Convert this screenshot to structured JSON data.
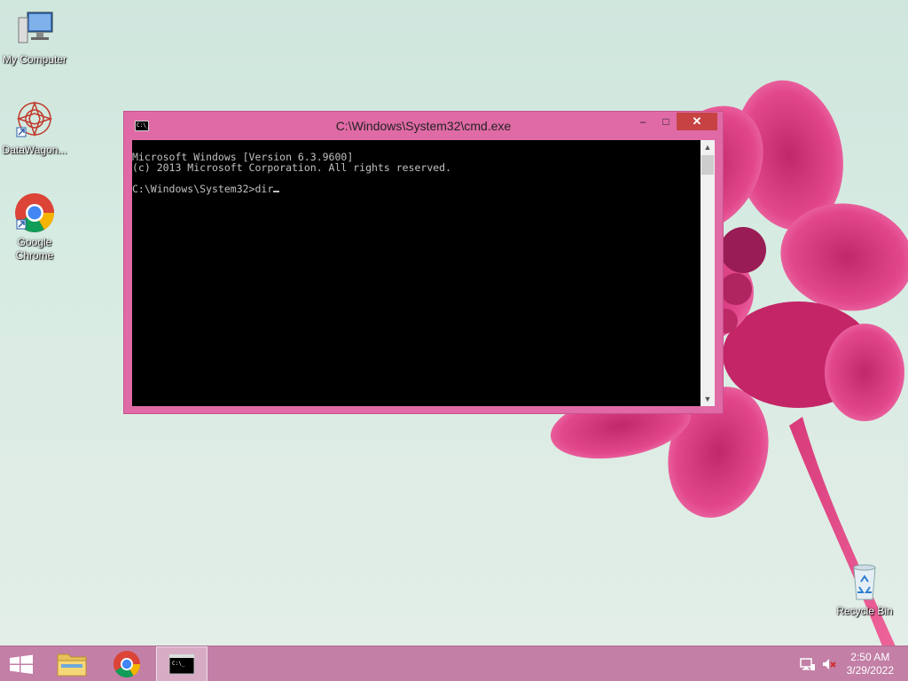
{
  "desktop": {
    "icons": [
      {
        "label": "My Computer",
        "icon": "computer-icon"
      },
      {
        "label": "DataWagon...",
        "icon": "datawagon-icon"
      },
      {
        "label": "Google Chrome",
        "icon": "chrome-icon"
      },
      {
        "label": "Recycle Bin",
        "icon": "recycle-bin-icon"
      }
    ]
  },
  "cmd": {
    "title": "C:\\Windows\\System32\\cmd.exe",
    "icon_label": "C:\\_",
    "buttons": {
      "minimize": "–",
      "maximize": "□",
      "close": "✕"
    },
    "lines": [
      "Microsoft Windows [Version 6.3.9600]",
      "(c) 2013 Microsoft Corporation. All rights reserved.",
      "",
      "C:\\Windows\\System32>dir"
    ],
    "scroll": {
      "up": "▲",
      "down": "▼"
    }
  },
  "taskbar": {
    "items": [
      {
        "name": "start",
        "icon": "windows-start-icon"
      },
      {
        "name": "file-explorer",
        "icon": "folder-icon"
      },
      {
        "name": "chrome",
        "icon": "chrome-icon"
      },
      {
        "name": "cmd",
        "icon": "command-prompt-icon",
        "active": true
      }
    ],
    "tray": {
      "network_icon": "network-icon",
      "volume_icon": "volume-muted-icon",
      "time": "2:50 AM",
      "date": "3/29/2022"
    }
  },
  "colors": {
    "window_frame": "#e06aa6",
    "close_button": "#c74343",
    "taskbar": "#c37fa6",
    "console_bg": "#000000",
    "console_text": "#c0c0c0"
  }
}
